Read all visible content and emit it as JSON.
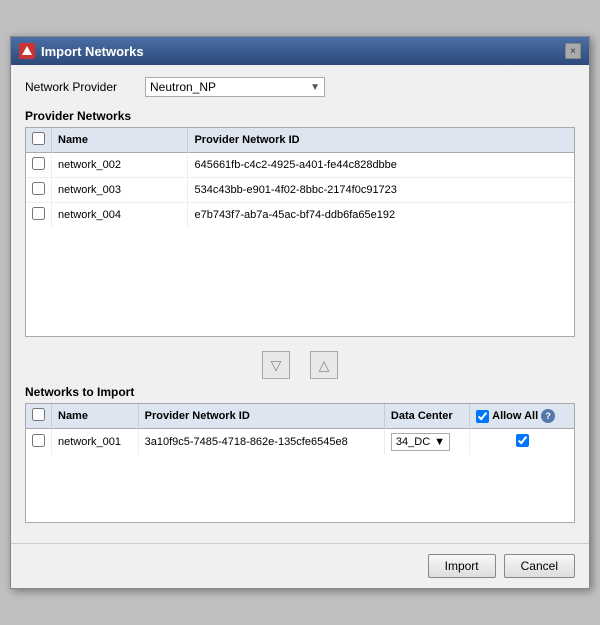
{
  "dialog": {
    "title": "Import Networks",
    "close_label": "×"
  },
  "network_provider": {
    "label": "Network Provider",
    "value": "Neutron_NP",
    "options": [
      "Neutron_NP"
    ]
  },
  "provider_networks": {
    "section_title": "Provider Networks",
    "columns": [
      "Name",
      "Provider Network ID"
    ],
    "rows": [
      {
        "name": "network_002",
        "id": "645661fb-c4c2-4925-a401-fe44c828dbbe"
      },
      {
        "name": "network_003",
        "id": "534c43bb-e901-4f02-8bbc-2174f0c91723"
      },
      {
        "name": "network_004",
        "id": "e7b743f7-ab7a-45ac-bf74-ddb6fa65e192"
      }
    ]
  },
  "networks_to_import": {
    "section_title": "Networks to Import",
    "columns": [
      "Name",
      "Provider Network ID",
      "Data Center",
      "Allow All"
    ],
    "rows": [
      {
        "name": "network_001",
        "id": "3a10f9c5-7485-4718-862e-135cfe6545e8",
        "dc": "34_DC",
        "allow": true
      }
    ]
  },
  "buttons": {
    "import": "Import",
    "cancel": "Cancel"
  },
  "icons": {
    "down_arrow": "▽",
    "up_arrow": "△",
    "dropdown_arrow": "▼",
    "info": "?"
  }
}
